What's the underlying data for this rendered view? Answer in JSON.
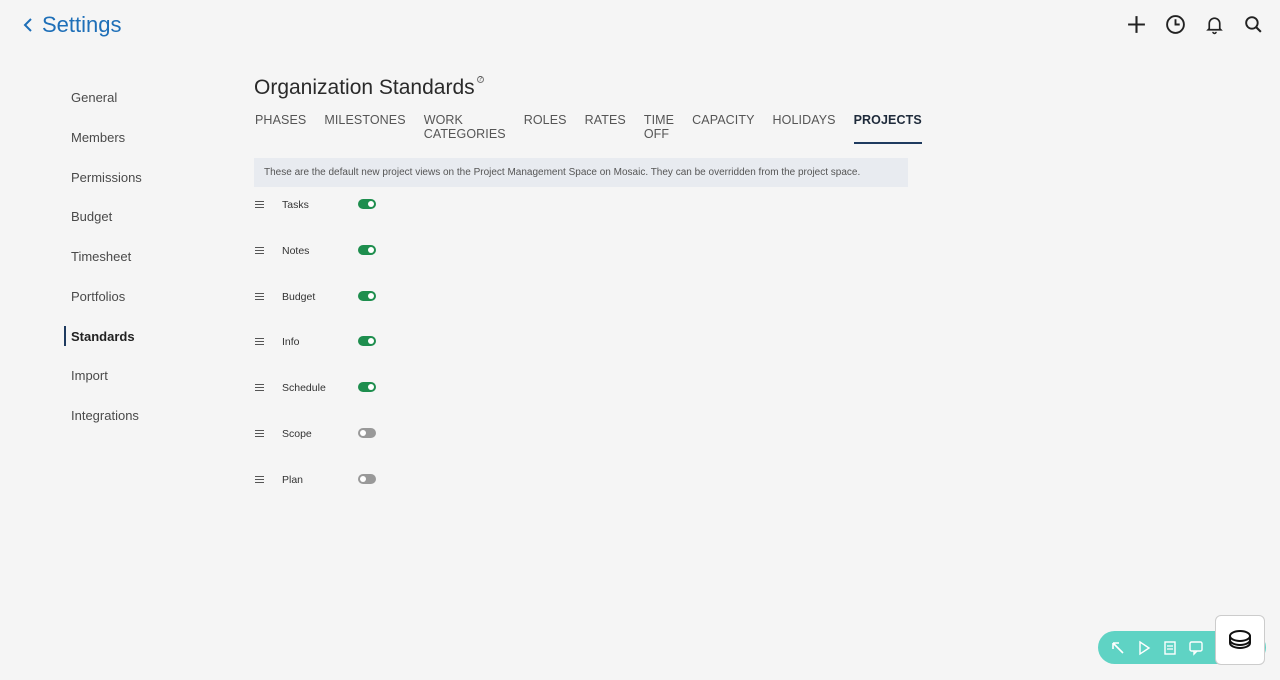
{
  "header": {
    "back_label": "Settings"
  },
  "sidebar": {
    "items": [
      {
        "label": "General",
        "active": false
      },
      {
        "label": "Members",
        "active": false
      },
      {
        "label": "Permissions",
        "active": false
      },
      {
        "label": "Budget",
        "active": false
      },
      {
        "label": "Timesheet",
        "active": false
      },
      {
        "label": "Portfolios",
        "active": false
      },
      {
        "label": "Standards",
        "active": true
      },
      {
        "label": "Import",
        "active": false
      },
      {
        "label": "Integrations",
        "active": false
      }
    ]
  },
  "main": {
    "title": "Organization Standards",
    "help_glyph": "?",
    "tabs": [
      {
        "label": "PHASES",
        "active": false
      },
      {
        "label": "MILESTONES",
        "active": false
      },
      {
        "label": "WORK CATEGORIES",
        "active": false
      },
      {
        "label": "ROLES",
        "active": false
      },
      {
        "label": "RATES",
        "active": false
      },
      {
        "label": "TIME OFF",
        "active": false
      },
      {
        "label": "CAPACITY",
        "active": false
      },
      {
        "label": "HOLIDAYS",
        "active": false
      },
      {
        "label": "PROJECTS",
        "active": true
      }
    ],
    "info_text": "These are the default new project views on the Project Management Space on Mosaic. They can be overridden from the project space.",
    "views": [
      {
        "label": "Tasks",
        "enabled": true
      },
      {
        "label": "Notes",
        "enabled": true
      },
      {
        "label": "Budget",
        "enabled": true
      },
      {
        "label": "Info",
        "enabled": true
      },
      {
        "label": "Schedule",
        "enabled": true
      },
      {
        "label": "Scope",
        "enabled": false
      },
      {
        "label": "Plan",
        "enabled": false
      }
    ]
  },
  "colors": {
    "accent": "#1e6fb8",
    "toggle_on": "#1e8e4e",
    "toggle_off": "#999999",
    "widget": "#5fd3c4"
  }
}
